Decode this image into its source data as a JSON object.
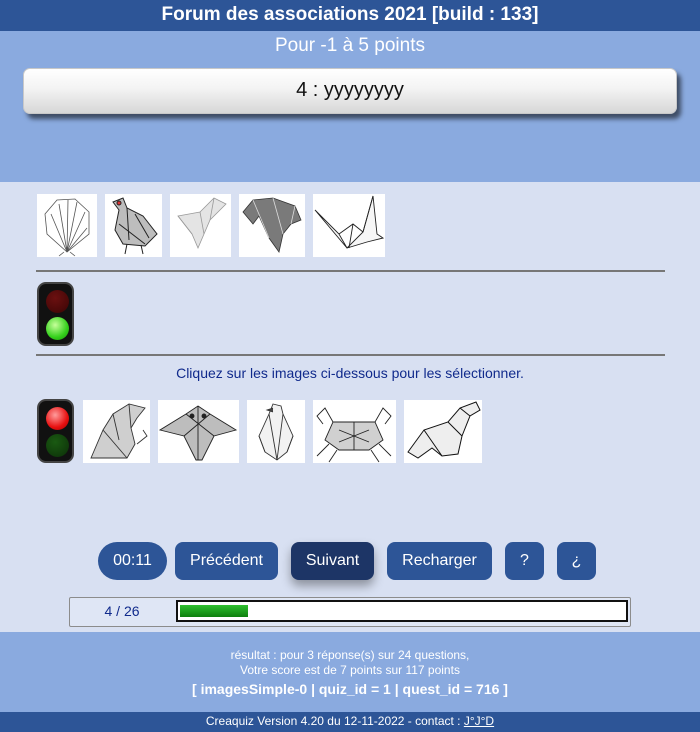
{
  "app": {
    "title": "Forum des associations 2021 [build : 133]",
    "points": "Pour -1 à 5 points",
    "question": "4 : yyyyyyyy"
  },
  "selected_images": [
    "peacock-origami",
    "turkey-origami",
    "dove-origami",
    "elephant-origami",
    "crane-origami"
  ],
  "instruction": "Cliquez sur les images ci-dessous pour les sélectionner.",
  "choice_images": [
    "beaver-origami",
    "owl-origami",
    "penguin-origami",
    "crab-origami",
    "seal-origami"
  ],
  "lights": {
    "top": "green",
    "bottom": "red"
  },
  "buttons": {
    "timer": "00:11",
    "prev": "Précédent",
    "next": "Suivant",
    "reload": "Recharger",
    "help": "?",
    "inverted_help": "¿"
  },
  "progress": {
    "label": "4 / 26",
    "fraction": 0.154
  },
  "footer": {
    "line1": "résultat : pour 3 réponse(s) sur 24 questions,",
    "line2": "Votre score est de 7 points sur 117 points",
    "line3": "[ imagesSimple-0 | quiz_id = 1 | quest_id = 716 ]",
    "version": "Creaquiz Version 4.20 du 12-11-2022 - contact : ",
    "contact": "J°J°D"
  },
  "colors": {
    "header_dark": "#2d5597",
    "header_light": "#8aaadf",
    "body_bg": "#d8e0f2",
    "progress_green": "#1aa11a"
  }
}
